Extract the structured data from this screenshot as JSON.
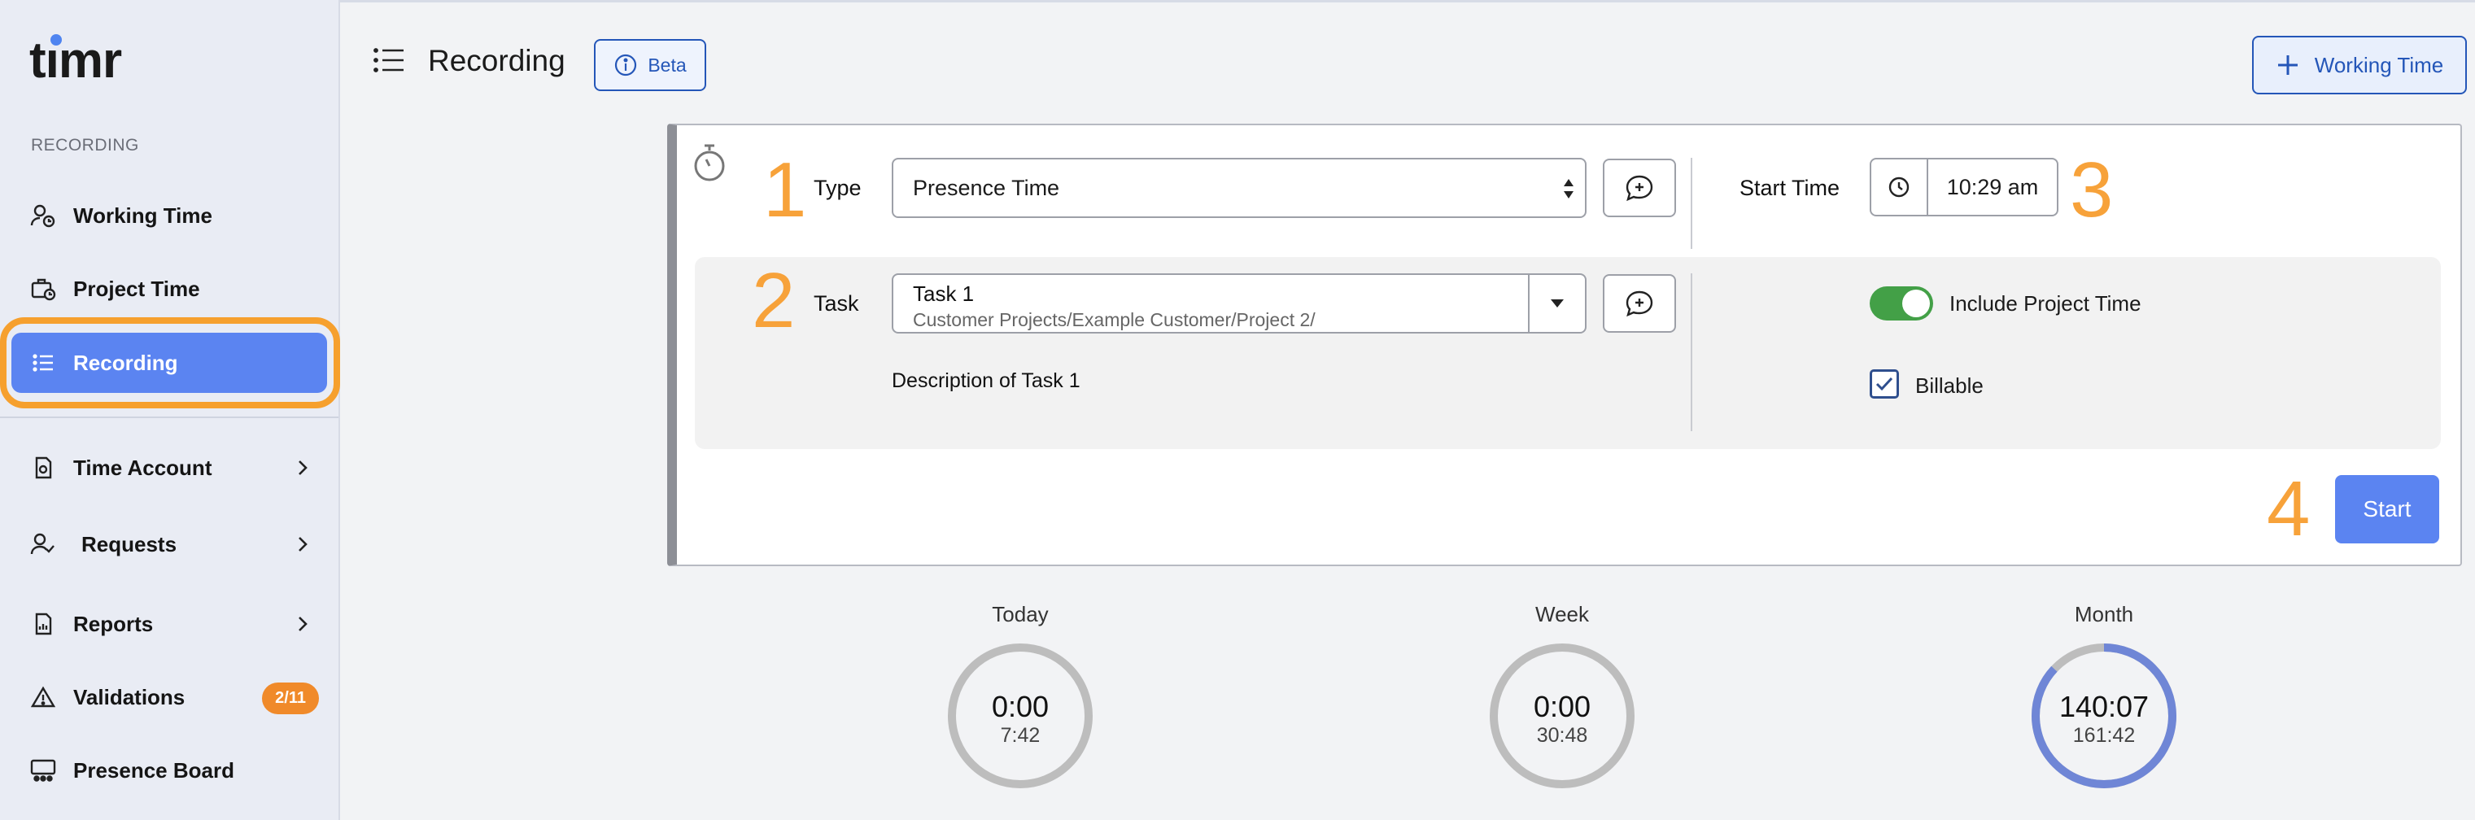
{
  "app": {
    "logo": "timr"
  },
  "sidebar": {
    "section_label": "RECORDING",
    "items": [
      {
        "label": "Working Time",
        "icon": "user-clock-icon"
      },
      {
        "label": "Project Time",
        "icon": "briefcase-clock-icon"
      },
      {
        "label": "Recording",
        "icon": "list-icon",
        "active": true
      },
      {
        "label": "Time Account",
        "icon": "time-account-icon",
        "has_submenu": true
      },
      {
        "label": "Requests",
        "icon": "user-check-icon",
        "has_submenu": true
      },
      {
        "label": "Reports",
        "icon": "report-icon",
        "has_submenu": true
      },
      {
        "label": "Validations",
        "icon": "warning-icon",
        "badge": "2/11"
      },
      {
        "label": "Presence Board",
        "icon": "presence-board-icon"
      }
    ]
  },
  "header": {
    "title": "Recording",
    "beta_label": "Beta",
    "working_time_button": "Working Time"
  },
  "form": {
    "step_numbers": [
      "1",
      "2",
      "3",
      "4"
    ],
    "type_label": "Type",
    "type_value": "Presence Time",
    "start_time_label": "Start Time",
    "start_time_value": "10:29 am",
    "task_label": "Task",
    "task_name": "Task 1",
    "task_path": "Customer Projects/Example Customer/Project 2/",
    "task_description": "Description of Task 1",
    "include_project_time_label": "Include Project Time",
    "include_project_time_on": true,
    "billable_label": "Billable",
    "billable_checked": true,
    "start_button": "Start"
  },
  "stats": [
    {
      "label": "Today",
      "value": "0:00",
      "target": "7:42",
      "progress": 0
    },
    {
      "label": "Week",
      "value": "0:00",
      "target": "30:48",
      "progress": 0
    },
    {
      "label": "Month",
      "value": "140:07",
      "target": "161:42",
      "progress": 0.87
    }
  ],
  "colors": {
    "accent": "#5b84f1",
    "highlight_orange": "#f7a23a",
    "toggle_green": "#43a047",
    "ring_progress": "#6f86d6",
    "ring_track": "#bdbdbd",
    "badge_orange": "#f08a2a"
  }
}
